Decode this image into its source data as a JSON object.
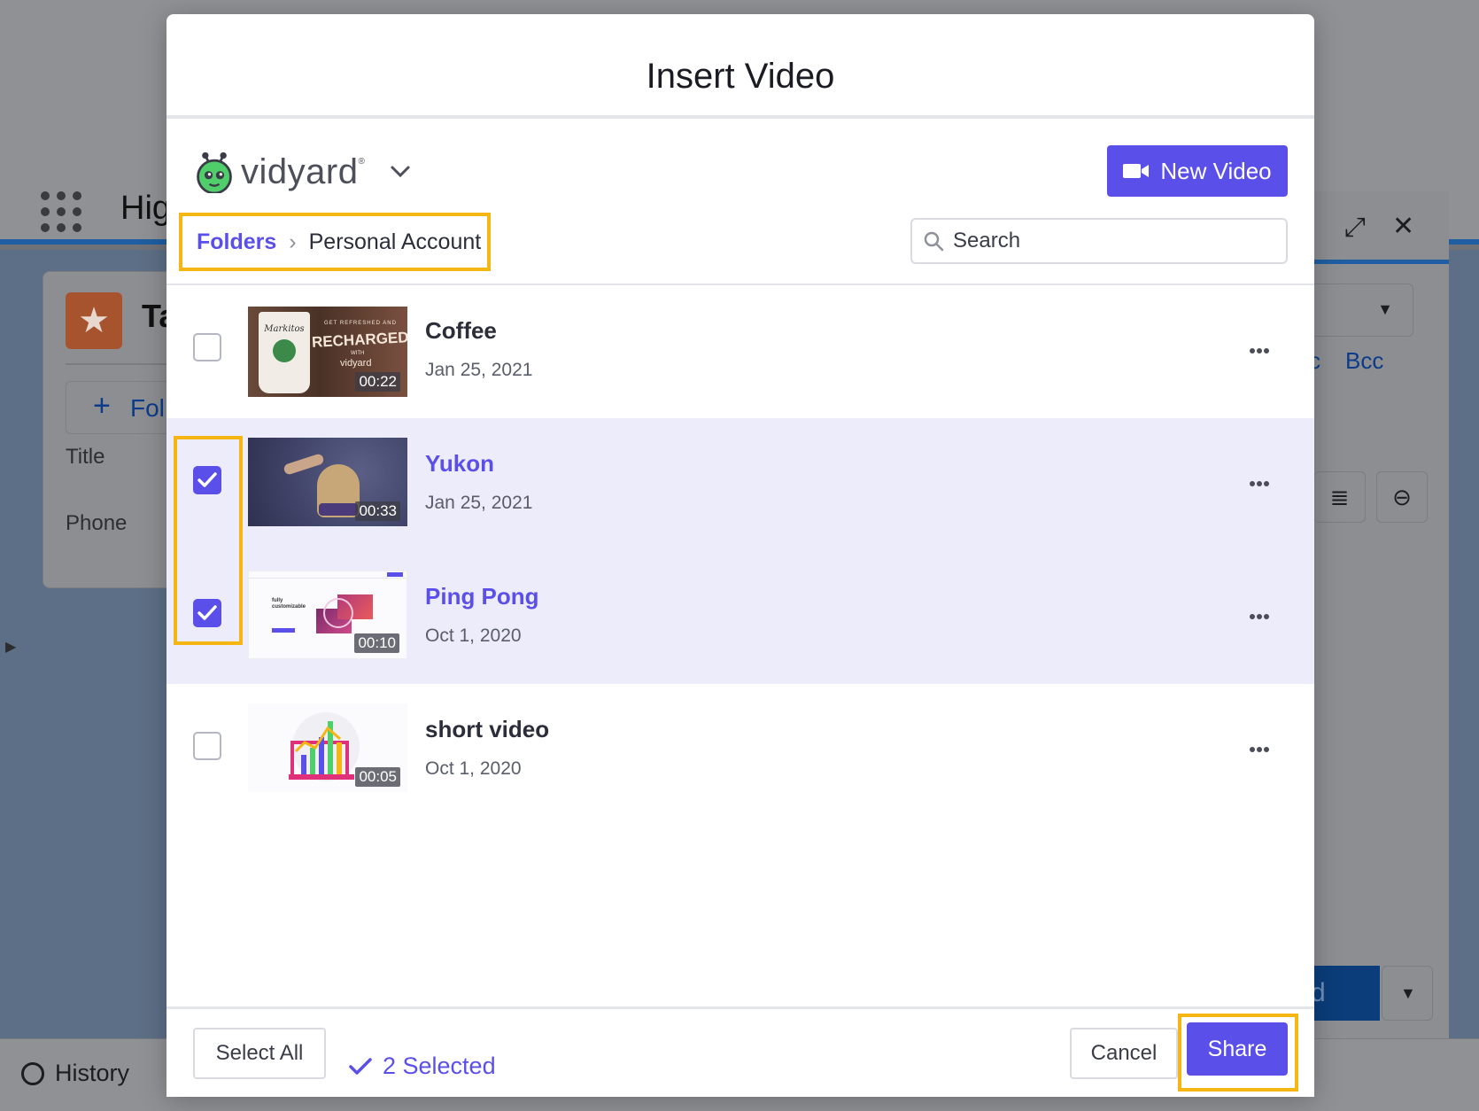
{
  "background": {
    "header_title": "Hig",
    "record_abbrev": "Ta",
    "folder_button": "Fol",
    "fields": [
      "Title",
      "Phone"
    ],
    "cc_partial": "c",
    "bcc": "Bcc",
    "send_partial": "d",
    "history": "History"
  },
  "modal": {
    "title": "Insert Video",
    "brand": "vidyard",
    "brand_mark": "®",
    "new_video_label": "New Video",
    "breadcrumb": {
      "root": "Folders",
      "current": "Personal Account"
    },
    "search": {
      "placeholder": "Search",
      "value": ""
    },
    "videos": [
      {
        "name": "Coffee",
        "date": "Jan 25, 2021",
        "duration": "00:22",
        "selected": false,
        "thumb_text": [
          "Markitos",
          "GET REFRESHED AND",
          "RECHARGED",
          "WITH",
          "vidyard"
        ]
      },
      {
        "name": "Yukon",
        "date": "Jan 25, 2021",
        "duration": "00:33",
        "selected": true
      },
      {
        "name": "Ping Pong",
        "date": "Oct 1, 2020",
        "duration": "00:10",
        "selected": true,
        "thumb_text": [
          "fully",
          "customizable"
        ]
      },
      {
        "name": "short video",
        "date": "Oct 1, 2020",
        "duration": "00:05",
        "selected": false
      }
    ],
    "footer": {
      "select_all_label": "Select All",
      "selected_label": "2 Selected",
      "cancel_label": "Cancel",
      "share_label": "Share"
    }
  },
  "colors": {
    "accent": "#5b4fe9",
    "highlight": "#f5b614",
    "selected_row": "#ececfb"
  }
}
